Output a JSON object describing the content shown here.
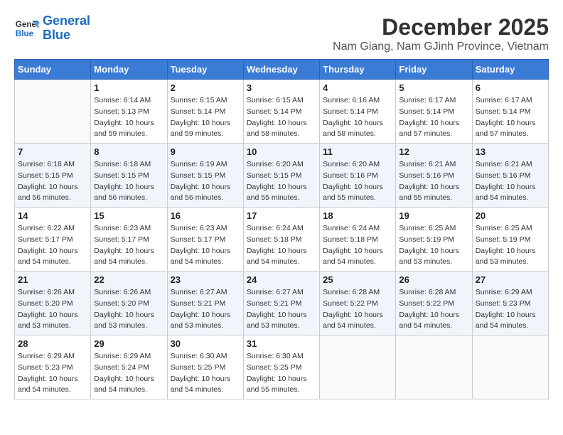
{
  "header": {
    "logo_line1": "General",
    "logo_line2": "Blue",
    "title": "December 2025",
    "subtitle": "Nam Giang, Nam GJinh Province, Vietnam"
  },
  "calendar": {
    "days_of_week": [
      "Sunday",
      "Monday",
      "Tuesday",
      "Wednesday",
      "Thursday",
      "Friday",
      "Saturday"
    ],
    "weeks": [
      [
        {
          "day": "",
          "info": ""
        },
        {
          "day": "1",
          "info": "Sunrise: 6:14 AM\nSunset: 5:13 PM\nDaylight: 10 hours\nand 59 minutes."
        },
        {
          "day": "2",
          "info": "Sunrise: 6:15 AM\nSunset: 5:14 PM\nDaylight: 10 hours\nand 59 minutes."
        },
        {
          "day": "3",
          "info": "Sunrise: 6:15 AM\nSunset: 5:14 PM\nDaylight: 10 hours\nand 58 minutes."
        },
        {
          "day": "4",
          "info": "Sunrise: 6:16 AM\nSunset: 5:14 PM\nDaylight: 10 hours\nand 58 minutes."
        },
        {
          "day": "5",
          "info": "Sunrise: 6:17 AM\nSunset: 5:14 PM\nDaylight: 10 hours\nand 57 minutes."
        },
        {
          "day": "6",
          "info": "Sunrise: 6:17 AM\nSunset: 5:14 PM\nDaylight: 10 hours\nand 57 minutes."
        }
      ],
      [
        {
          "day": "7",
          "info": "Sunrise: 6:18 AM\nSunset: 5:15 PM\nDaylight: 10 hours\nand 56 minutes."
        },
        {
          "day": "8",
          "info": "Sunrise: 6:18 AM\nSunset: 5:15 PM\nDaylight: 10 hours\nand 56 minutes."
        },
        {
          "day": "9",
          "info": "Sunrise: 6:19 AM\nSunset: 5:15 PM\nDaylight: 10 hours\nand 56 minutes."
        },
        {
          "day": "10",
          "info": "Sunrise: 6:20 AM\nSunset: 5:15 PM\nDaylight: 10 hours\nand 55 minutes."
        },
        {
          "day": "11",
          "info": "Sunrise: 6:20 AM\nSunset: 5:16 PM\nDaylight: 10 hours\nand 55 minutes."
        },
        {
          "day": "12",
          "info": "Sunrise: 6:21 AM\nSunset: 5:16 PM\nDaylight: 10 hours\nand 55 minutes."
        },
        {
          "day": "13",
          "info": "Sunrise: 6:21 AM\nSunset: 5:16 PM\nDaylight: 10 hours\nand 54 minutes."
        }
      ],
      [
        {
          "day": "14",
          "info": "Sunrise: 6:22 AM\nSunset: 5:17 PM\nDaylight: 10 hours\nand 54 minutes."
        },
        {
          "day": "15",
          "info": "Sunrise: 6:23 AM\nSunset: 5:17 PM\nDaylight: 10 hours\nand 54 minutes."
        },
        {
          "day": "16",
          "info": "Sunrise: 6:23 AM\nSunset: 5:17 PM\nDaylight: 10 hours\nand 54 minutes."
        },
        {
          "day": "17",
          "info": "Sunrise: 6:24 AM\nSunset: 5:18 PM\nDaylight: 10 hours\nand 54 minutes."
        },
        {
          "day": "18",
          "info": "Sunrise: 6:24 AM\nSunset: 5:18 PM\nDaylight: 10 hours\nand 54 minutes."
        },
        {
          "day": "19",
          "info": "Sunrise: 6:25 AM\nSunset: 5:19 PM\nDaylight: 10 hours\nand 53 minutes."
        },
        {
          "day": "20",
          "info": "Sunrise: 6:25 AM\nSunset: 5:19 PM\nDaylight: 10 hours\nand 53 minutes."
        }
      ],
      [
        {
          "day": "21",
          "info": "Sunrise: 6:26 AM\nSunset: 5:20 PM\nDaylight: 10 hours\nand 53 minutes."
        },
        {
          "day": "22",
          "info": "Sunrise: 6:26 AM\nSunset: 5:20 PM\nDaylight: 10 hours\nand 53 minutes."
        },
        {
          "day": "23",
          "info": "Sunrise: 6:27 AM\nSunset: 5:21 PM\nDaylight: 10 hours\nand 53 minutes."
        },
        {
          "day": "24",
          "info": "Sunrise: 6:27 AM\nSunset: 5:21 PM\nDaylight: 10 hours\nand 53 minutes."
        },
        {
          "day": "25",
          "info": "Sunrise: 6:28 AM\nSunset: 5:22 PM\nDaylight: 10 hours\nand 54 minutes."
        },
        {
          "day": "26",
          "info": "Sunrise: 6:28 AM\nSunset: 5:22 PM\nDaylight: 10 hours\nand 54 minutes."
        },
        {
          "day": "27",
          "info": "Sunrise: 6:29 AM\nSunset: 5:23 PM\nDaylight: 10 hours\nand 54 minutes."
        }
      ],
      [
        {
          "day": "28",
          "info": "Sunrise: 6:29 AM\nSunset: 5:23 PM\nDaylight: 10 hours\nand 54 minutes."
        },
        {
          "day": "29",
          "info": "Sunrise: 6:29 AM\nSunset: 5:24 PM\nDaylight: 10 hours\nand 54 minutes."
        },
        {
          "day": "30",
          "info": "Sunrise: 6:30 AM\nSunset: 5:25 PM\nDaylight: 10 hours\nand 54 minutes."
        },
        {
          "day": "31",
          "info": "Sunrise: 6:30 AM\nSunset: 5:25 PM\nDaylight: 10 hours\nand 55 minutes."
        },
        {
          "day": "",
          "info": ""
        },
        {
          "day": "",
          "info": ""
        },
        {
          "day": "",
          "info": ""
        }
      ]
    ]
  }
}
